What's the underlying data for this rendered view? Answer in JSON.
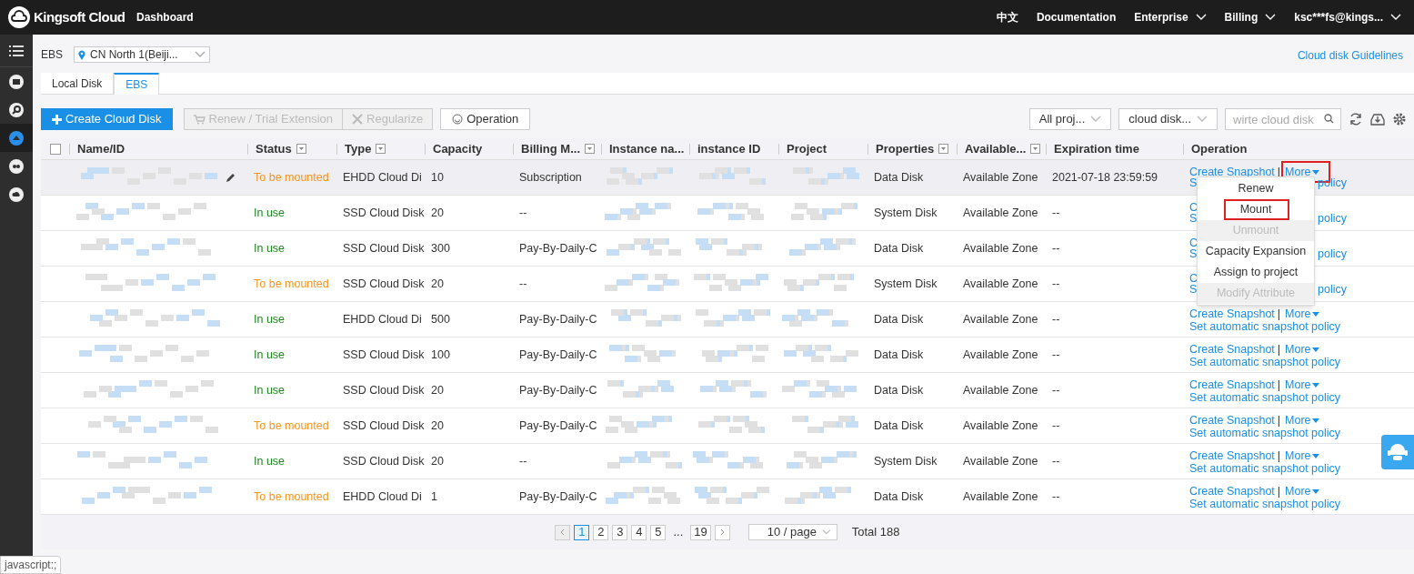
{
  "topbar": {
    "brand": "Kingsoft Cloud",
    "title": "Dashboard",
    "links": [
      {
        "label": "中文",
        "dropdown": false
      },
      {
        "label": "Documentation",
        "dropdown": false
      },
      {
        "label": "Enterprise",
        "dropdown": true
      },
      {
        "label": "Billing",
        "dropdown": true
      },
      {
        "label": "ksc***fs@kings...",
        "dropdown": true
      }
    ]
  },
  "sidebar": {
    "items": [
      {
        "selected": false
      },
      {
        "selected": false
      },
      {
        "selected": true
      },
      {
        "selected": false
      },
      {
        "selected": false
      }
    ]
  },
  "header": {
    "section": "EBS",
    "region": "CN North 1(Beiji...",
    "guide_link": "Cloud disk Guidelines"
  },
  "tabs": [
    {
      "label": "Local Disk",
      "selected": false
    },
    {
      "label": "EBS",
      "selected": true
    }
  ],
  "toolbar": {
    "buttons": [
      {
        "label": "Create Cloud Disk",
        "kind": "primary",
        "disabled": false
      },
      {
        "label": "Renew / Trial Extension",
        "kind": "cart",
        "disabled": true
      },
      {
        "label": "Regularize",
        "kind": "tools",
        "disabled": true
      },
      {
        "label": "Operation",
        "kind": "operation",
        "disabled": false
      }
    ],
    "project_filter": "All proj...",
    "type_filter": "cloud disk...",
    "search": {
      "placeholder": "wirte cloud disk"
    }
  },
  "table": {
    "select_all": {
      "checked": false
    },
    "columns": [
      {
        "label": "Name/ID",
        "filter": false
      },
      {
        "label": "Status",
        "filter": true
      },
      {
        "label": "Type",
        "filter": true
      },
      {
        "label": "Capacity",
        "filter": false
      },
      {
        "label": "Billing M...",
        "filter": true
      },
      {
        "label": "Instance na...",
        "filter": false
      },
      {
        "label": "instance ID",
        "filter": false
      },
      {
        "label": "Project",
        "filter": false
      },
      {
        "label": "Properties",
        "filter": true
      },
      {
        "label": "Available...",
        "filter": true
      },
      {
        "label": "Expiration time",
        "filter": false
      },
      {
        "label": "Operation",
        "filter": false
      }
    ],
    "rows": [
      {
        "highlighted": true,
        "status": {
          "text": "To be mounted",
          "color": "#f7941d"
        },
        "type": "EHDD Cloud Di",
        "capacity": "10",
        "billing": "Subscription",
        "properties": "Data Disk",
        "zone": "Available Zone",
        "expiration": "2021-07-18 23:59:59",
        "operation": {
          "snapshot": "Create Snapshot",
          "separator": "|",
          "more": "More",
          "more_annotated": true,
          "policy_start": "S",
          "policy_end": "policy"
        }
      },
      {
        "highlighted": false,
        "status": {
          "text": "In use",
          "color": "#1e8a1e"
        },
        "type": "SSD Cloud Disk",
        "capacity": "20",
        "billing": "--",
        "properties": "System Disk",
        "zone": "Available Zone",
        "expiration": "--",
        "operation": {
          "snapshot": "C",
          "policy_start": "S",
          "policy_end": "policy"
        }
      },
      {
        "highlighted": false,
        "status": {
          "text": "In use",
          "color": "#1e8a1e"
        },
        "type": "SSD Cloud Disk",
        "capacity": "300",
        "billing": "Pay-By-Daily-C",
        "properties": "Data Disk",
        "zone": "Available Zone",
        "expiration": "--",
        "operation": {
          "snapshot": "C",
          "policy_start": "S",
          "policy_end": "policy"
        }
      },
      {
        "highlighted": false,
        "status": {
          "text": "To be mounted",
          "color": "#f7941d"
        },
        "type": "SSD Cloud Disk",
        "capacity": "20",
        "billing": "--",
        "properties": "System Disk",
        "zone": "Available Zone",
        "expiration": "--",
        "operation": {
          "snapshot": "C",
          "policy_start": "S",
          "policy_end": "policy"
        }
      },
      {
        "highlighted": false,
        "status": {
          "text": "In use",
          "color": "#1e8a1e"
        },
        "type": "EHDD Cloud Di",
        "capacity": "500",
        "billing": "Pay-By-Daily-C",
        "properties": "Data Disk",
        "zone": "Available Zone",
        "expiration": "--",
        "operation": {
          "snapshot": "Create Snapshot",
          "separator": "|",
          "more": "More",
          "policy": "Set automatic snapshot policy"
        }
      },
      {
        "highlighted": false,
        "status": {
          "text": "In use",
          "color": "#1e8a1e"
        },
        "type": "SSD Cloud Disk",
        "capacity": "100",
        "billing": "Pay-By-Daily-C",
        "properties": "Data Disk",
        "zone": "Available Zone",
        "expiration": "--",
        "operation": {
          "snapshot": "Create Snapshot",
          "separator": "|",
          "more": "More",
          "policy": "Set automatic snapshot policy"
        }
      },
      {
        "highlighted": false,
        "status": {
          "text": "In use",
          "color": "#1e8a1e"
        },
        "type": "SSD Cloud Disk",
        "capacity": "20",
        "billing": "Pay-By-Daily-C",
        "properties": "Data Disk",
        "zone": "Available Zone",
        "expiration": "--",
        "operation": {
          "snapshot": "Create Snapshot",
          "separator": "|",
          "more": "More",
          "policy": "Set automatic snapshot policy"
        }
      },
      {
        "highlighted": false,
        "status": {
          "text": "To be mounted",
          "color": "#f7941d"
        },
        "type": "SSD Cloud Disk",
        "capacity": "20",
        "billing": "Pay-By-Daily-C",
        "properties": "Data Disk",
        "zone": "Available Zone",
        "expiration": "--",
        "operation": {
          "snapshot": "Create Snapshot",
          "separator": "|",
          "more": "More",
          "policy": "Set automatic snapshot policy"
        }
      },
      {
        "highlighted": false,
        "status": {
          "text": "In use",
          "color": "#1e8a1e"
        },
        "type": "SSD Cloud Disk",
        "capacity": "20",
        "billing": "--",
        "properties": "System Disk",
        "zone": "Available Zone",
        "expiration": "--",
        "operation": {
          "snapshot": "Create Snapshot",
          "separator": "|",
          "more": "More",
          "policy": "Set automatic snapshot policy"
        }
      },
      {
        "highlighted": false,
        "status": {
          "text": "To be mounted",
          "color": "#f7941d"
        },
        "type": "EHDD Cloud Di",
        "capacity": "1",
        "billing": "Pay-By-Daily-C",
        "properties": "Data Disk",
        "zone": "Available Zone",
        "expiration": "--",
        "operation": {
          "snapshot": "Create Snapshot",
          "separator": "|",
          "more": "More",
          "policy": "Set automatic snapshot policy"
        }
      }
    ]
  },
  "more_menu": {
    "items": [
      {
        "label": "Renew",
        "disabled": false,
        "annotated": false
      },
      {
        "label": "Mount",
        "disabled": false,
        "annotated": true
      },
      {
        "label": "Unmount",
        "disabled": true,
        "annotated": false
      },
      {
        "label": "Capacity Expansion",
        "disabled": false,
        "annotated": false
      },
      {
        "label": "Assign to project",
        "disabled": false,
        "annotated": false
      },
      {
        "label": "Modify Attribute",
        "disabled": true,
        "annotated": false
      }
    ]
  },
  "pagination": {
    "pages": [
      {
        "label": "1",
        "selected": true
      },
      {
        "label": "2",
        "selected": false
      },
      {
        "label": "3",
        "selected": false
      },
      {
        "label": "4",
        "selected": false
      },
      {
        "label": "5",
        "selected": false
      },
      {
        "label": "...",
        "selected": false
      },
      {
        "label": "19",
        "selected": false
      }
    ],
    "page_size": "10 / page",
    "total": "Total 188"
  },
  "status_bar": "javascript:;"
}
